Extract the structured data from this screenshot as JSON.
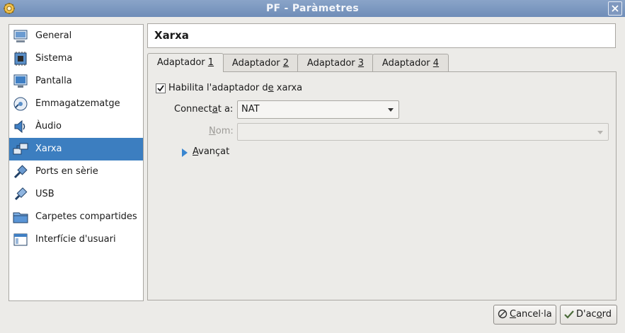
{
  "window": {
    "title": "PF - Paràmetres"
  },
  "sidebar": {
    "items": [
      {
        "label": "General",
        "icon": "monitor-icon"
      },
      {
        "label": "Sistema",
        "icon": "chip-icon"
      },
      {
        "label": "Pantalla",
        "icon": "display-icon"
      },
      {
        "label": "Emmagatzematge",
        "icon": "disk-icon"
      },
      {
        "label": "Àudio",
        "icon": "speaker-icon"
      },
      {
        "label": "Xarxa",
        "icon": "network-icon",
        "selected": true
      },
      {
        "label": "Ports en sèrie",
        "icon": "serial-port-icon"
      },
      {
        "label": "USB",
        "icon": "usb-icon"
      },
      {
        "label": "Carpetes compartides",
        "icon": "folder-icon"
      },
      {
        "label": "Interfície d'usuari",
        "icon": "window-icon"
      }
    ]
  },
  "header": {
    "title": "Xarxa"
  },
  "tabs": [
    {
      "label_a": "Adaptador ",
      "label_u": "1",
      "active": true
    },
    {
      "label_a": "Adaptador ",
      "label_u": "2"
    },
    {
      "label_a": "Adaptador ",
      "label_u": "3"
    },
    {
      "label_a": "Adaptador ",
      "label_u": "4"
    }
  ],
  "panel": {
    "enable": {
      "a": "Habilita l'adaptador d",
      "u": "e",
      "b": " xarxa",
      "checked": true
    },
    "attached": {
      "label_a": "Connect",
      "label_u": "a",
      "label_b": "t a:",
      "value": "NAT"
    },
    "name": {
      "label_u": "N",
      "label_b": "om:",
      "value": ""
    },
    "advanced": {
      "u": "A",
      "b": "vançat"
    }
  },
  "buttons": {
    "cancel": {
      "u": "C",
      "b": "ancel·la"
    },
    "ok": {
      "a": "D'ac",
      "u": "o",
      "b": "rd"
    }
  },
  "colors": {
    "titlebar": "#7a96c0",
    "selection": "#3c7ec0",
    "accent": "#3a86d0"
  }
}
